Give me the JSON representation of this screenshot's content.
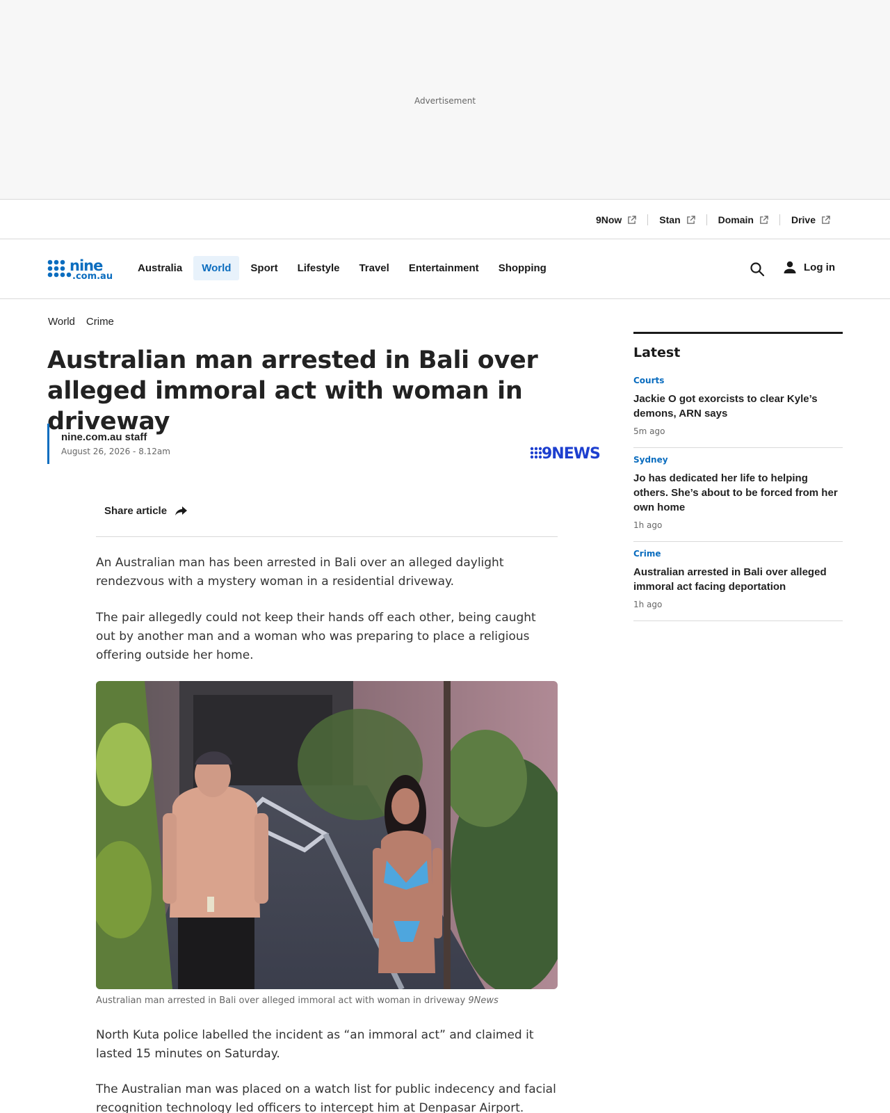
{
  "ad": {
    "label": "Advertisement"
  },
  "partners": [
    {
      "label": "9Now",
      "icon": "external-link-icon"
    },
    {
      "label": "Stan",
      "icon": "external-link-icon"
    },
    {
      "label": "Domain",
      "icon": "external-link-icon"
    },
    {
      "label": "Drive",
      "icon": "external-link-icon"
    }
  ],
  "nav": {
    "logo_alt": "nine.com.au",
    "items": [
      {
        "label": "Australia"
      },
      {
        "label": "World",
        "active": true
      },
      {
        "label": "Sport"
      },
      {
        "label": "Lifestyle"
      },
      {
        "label": "Travel"
      },
      {
        "label": "Entertainment"
      },
      {
        "label": "Shopping"
      }
    ],
    "search_icon": "search-icon",
    "login_label": "Log in"
  },
  "article": {
    "breadcrumb": [
      "World",
      "Crime"
    ],
    "headline": "Australian man arrested in Bali over alleged immoral act with woman in driveway",
    "author": "nine.com.au staff",
    "date": "August 26, 2026 - 8.12am",
    "brand": "9NEWS",
    "share_label": "Share article",
    "paragraphs": [
      "An Australian man has been arrested in Bali over an alleged daylight rendezvous with a mystery woman in a residential driveway.",
      "The pair allegedly could not keep their hands off each other, being caught out by another man and a woman who was preparing to place a religious offering outside her home.",
      "North Kuta police labelled the incident as “an immoral act” and claimed it lasted 15 minutes on Saturday.",
      "The Australian man was placed on a watch list for public indecency and facial recognition technology led officers to intercept him at Denpasar Airport."
    ],
    "image_caption": "Australian man arrested in Bali over alleged immoral act with woman in driveway",
    "image_credit": "9News"
  },
  "sidebar": {
    "title": "Latest",
    "items": [
      {
        "category": "Courts",
        "headline": "Jackie O got exorcists to clear Kyle’s demons, ARN says",
        "time": "5m ago"
      },
      {
        "category": "Sydney",
        "headline": "Jo has dedicated her life to helping others. She’s about to be forced from her own home",
        "time": "1h ago"
      },
      {
        "category": "Crime",
        "headline": "Australian arrested in Bali over alleged immoral act facing deportation",
        "time": "1h ago"
      }
    ]
  },
  "colors": {
    "accent": "#0b6dbf",
    "brand_news": "#1d3fcf",
    "text": "#222222"
  }
}
